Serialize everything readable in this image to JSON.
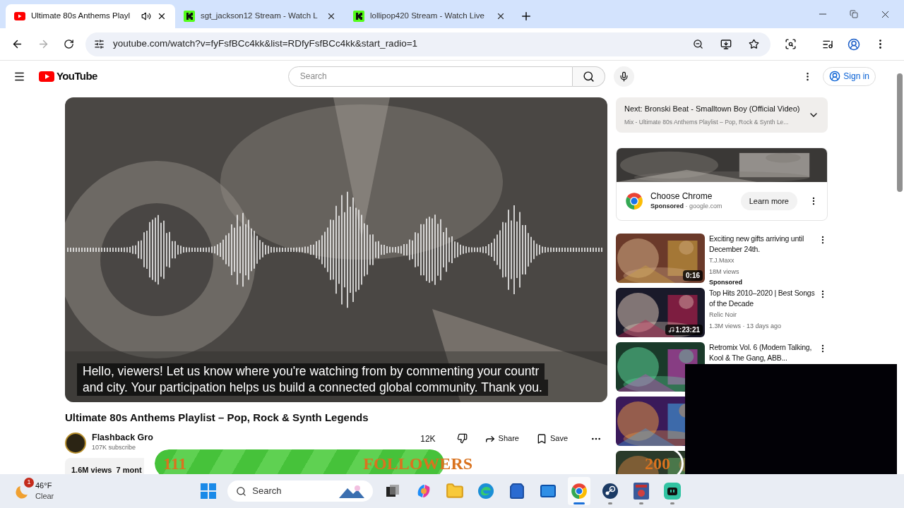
{
  "browser": {
    "tabs": [
      {
        "title": "Ultimate 80s Anthems Playl",
        "selected": true,
        "playing_audio": true,
        "kind": "youtube"
      },
      {
        "title": "sgt_jackson12 Stream - Watch L",
        "selected": false,
        "playing_audio": false,
        "kind": "kick"
      },
      {
        "title": "lollipop420 Stream - Watch Live",
        "selected": false,
        "playing_audio": false,
        "kind": "kick"
      }
    ],
    "url": "youtube.com/watch?v=fyFsfBCc4kk&list=RDfyFsfBCc4kk&start_radio=1"
  },
  "header": {
    "logo": "YouTube",
    "search_placeholder": "Search",
    "sign_in": "Sign in"
  },
  "video": {
    "captions": [
      "Hello, viewers! Let us know where you're watching from by commenting your countr",
      "and city. Your participation helps us build a connected global community. Thank you."
    ],
    "title": "Ultimate 80s Anthems Playlist – Pop, Rock & Synth Legends",
    "channel": "Flashback Gro",
    "subscribers": "107K subscribe",
    "likes": "12K",
    "share": "Share",
    "save": "Save",
    "description": "1.6M views  7 mont"
  },
  "sidebar": {
    "next": {
      "label": "Next:",
      "title": "Bronski Beat - Smalltown Boy (Official Video)",
      "playlist": "Mix - Ultimate 80s Anthems Playlist – Pop, Rock & Synth Le..."
    },
    "ad": {
      "kind": "picture",
      "title": "Choose Chrome",
      "sponsored": "Sponsored",
      "domain": "· google.com",
      "button": "Learn more"
    },
    "videos": [
      {
        "title": "Exciting new gifts arriving until December 24th.",
        "channel": "T.J.Maxx",
        "meta": "18M views",
        "badge": "Sponsored",
        "duration": "0:16",
        "music": false
      },
      {
        "title": "Top Hits 2010–2020 | Best Songs of the Decade",
        "channel": "Relic Noir",
        "meta": "1.3M views · 13 days ago",
        "duration": "1:23:21",
        "music": true
      },
      {
        "title": "Retromix Vol. 6 (Modern Talking, Kool & The Gang, ABB..."
      },
      {
        "kind": "picture"
      },
      {
        "kind": "picture"
      }
    ]
  },
  "overlay": {
    "count": "111",
    "label": "FOLLOWERS",
    "goal": "200",
    "level": 0.55
  },
  "taskbar": {
    "weather": {
      "badge": "1",
      "temperature": "46°F",
      "condition": "Clear"
    },
    "search_placeholder": "Search",
    "apps": [
      {
        "kind": "task-view",
        "active": false,
        "running": false
      },
      {
        "kind": "copilot",
        "active": false,
        "running": false
      },
      {
        "kind": "folder",
        "active": false,
        "running": false
      },
      {
        "kind": "edge",
        "active": false,
        "running": false
      },
      {
        "kind": "store",
        "active": false,
        "running": false
      },
      {
        "kind": "mail",
        "active": false,
        "running": false
      },
      {
        "kind": "chrome",
        "active": true,
        "running": true
      },
      {
        "kind": "steam",
        "active": false,
        "running": true
      },
      {
        "kind": "game",
        "active": false,
        "running": true
      },
      {
        "kind": "stream",
        "active": false,
        "running": true
      }
    ]
  }
}
